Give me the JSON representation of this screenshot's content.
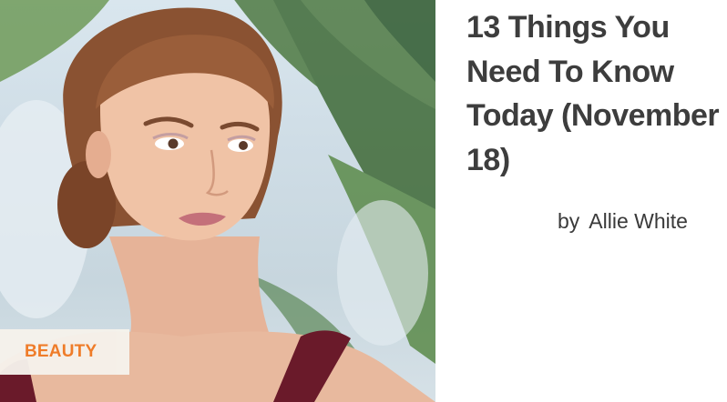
{
  "article": {
    "category": "BEAUTY",
    "title": "13 Things You Need To Know Today (November 18)",
    "byline_prefix": "by",
    "author": "Allie White"
  },
  "colors": {
    "category_accent": "#f07a25",
    "title_text": "#3d3d3d"
  }
}
